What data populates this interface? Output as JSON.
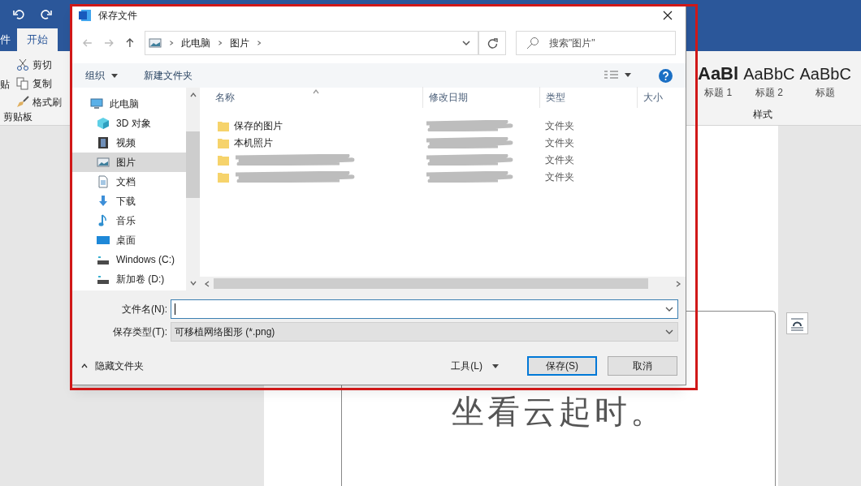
{
  "word": {
    "tabs": [
      {
        "label": "件",
        "selected": false
      },
      {
        "label": "开始",
        "selected": true
      }
    ],
    "clipboard": {
      "paste_label": "贴",
      "items": [
        {
          "label": "剪切",
          "kind": "cut"
        },
        {
          "label": "复制",
          "kind": "copy"
        },
        {
          "label": "格式刷",
          "kind": "brush"
        }
      ],
      "group_label": "剪贴板"
    },
    "styles": {
      "items": [
        {
          "preview": "AaBl",
          "label": "标题 1",
          "kind": "bold"
        },
        {
          "preview": "AaBbC",
          "label": "标题 2",
          "kind": "plain"
        },
        {
          "preview": "AaBbC",
          "label": "标题",
          "kind": "plain"
        }
      ],
      "group_label": "样式"
    },
    "document": {
      "text": "坐看云起时。"
    }
  },
  "dialog": {
    "title": "保存文件",
    "breadcrumb": [
      "此电脑",
      "图片"
    ],
    "search": {
      "placeholder": "搜索\"图片\""
    },
    "toolbar": {
      "organize": "组织",
      "new_folder": "新建文件夹"
    },
    "sidebar": {
      "items": [
        {
          "label": "此电脑",
          "kind": "computer",
          "selected": false
        },
        {
          "label": "3D 对象",
          "kind": "cube",
          "selected": false
        },
        {
          "label": "视频",
          "kind": "film",
          "selected": false
        },
        {
          "label": "图片",
          "kind": "pictures",
          "selected": true
        },
        {
          "label": "文档",
          "kind": "document",
          "selected": false
        },
        {
          "label": "下载",
          "kind": "download",
          "selected": false
        },
        {
          "label": "音乐",
          "kind": "music",
          "selected": false
        },
        {
          "label": "桌面",
          "kind": "desktop",
          "selected": false
        },
        {
          "label": "Windows (C:)",
          "kind": "drive",
          "selected": false
        },
        {
          "label": "新加卷 (D:)",
          "kind": "drive",
          "selected": false
        }
      ]
    },
    "columns": [
      "名称",
      "修改日期",
      "类型",
      "大小"
    ],
    "rows": [
      {
        "name": "保存的图片",
        "type": "文件夹"
      },
      {
        "name": "本机照片",
        "type": "文件夹"
      },
      {
        "type": "文件夹"
      },
      {
        "type": "文件夹"
      }
    ],
    "filename": {
      "label": "文件名(N):"
    },
    "filetype": {
      "label": "保存类型(T):",
      "value": "可移植网络图形 (*.png)"
    },
    "hide_folders": "隐藏文件夹",
    "tools": "工具(L)",
    "buttons": [
      {
        "label": "保存(S)",
        "default": true
      },
      {
        "label": "取消",
        "default": false
      }
    ]
  }
}
